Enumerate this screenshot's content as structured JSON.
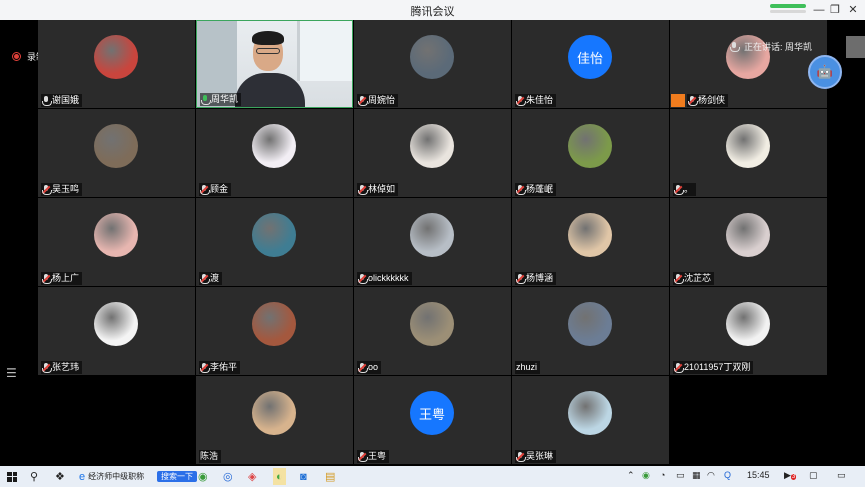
{
  "window": {
    "title": "腾讯会议",
    "minimize_glyph": "—",
    "restore_glyph": "❐",
    "close_glyph": "✕"
  },
  "recording": {
    "label": "录制中"
  },
  "speaking": {
    "label": "正在讲话: 周华凯"
  },
  "bot_glyph": "🤖",
  "participants": [
    {
      "name": "谢国娥",
      "mic": "on",
      "avatar_color": "#c9453d"
    },
    {
      "name": "周华凯",
      "mic": "green",
      "video": true
    },
    {
      "name": "周婉怡",
      "mic": "muted",
      "avatar_color": "#5b6a78"
    },
    {
      "name": "朱佳怡",
      "mic": "muted",
      "avatar_text": "佳怡"
    },
    {
      "name": "杨剑侠",
      "mic": "muted",
      "avatar_color": "#e7a7a1",
      "badge": true
    },
    {
      "name": "吴玉鸣",
      "mic": "muted",
      "avatar_color": "#7e6c59"
    },
    {
      "name": "顾金",
      "mic": "muted",
      "avatar_color": "#f2eef4"
    },
    {
      "name": "林倬如",
      "mic": "muted",
      "avatar_color": "#e9e4de"
    },
    {
      "name": "杨蓬岷",
      "mic": "muted",
      "avatar_color": "#7c9a4a"
    },
    {
      "name": "。",
      "mic": "muted",
      "avatar_color": "#f1ede3"
    },
    {
      "name": "杨上广",
      "mic": "muted",
      "avatar_color": "#e7b6b0"
    },
    {
      "name": "渡",
      "mic": "muted",
      "avatar_color": "#3f7d93"
    },
    {
      "name": "olickkkkkk",
      "mic": "muted",
      "avatar_color": "#b7bec6"
    },
    {
      "name": "杨博涵",
      "mic": "muted",
      "avatar_color": "#e0c6a7"
    },
    {
      "name": "沈芷芯",
      "mic": "muted",
      "avatar_color": "#d9cfcf"
    },
    {
      "name": "张艺玮",
      "mic": "muted",
      "avatar_color": "#f4f4f4"
    },
    {
      "name": "李佑平",
      "mic": "muted",
      "avatar_color": "#a4583e"
    },
    {
      "name": "oo",
      "mic": "muted",
      "avatar_color": "#9c8f76"
    },
    {
      "name": "zhuzi",
      "mic": "none",
      "avatar_color": "#6c7d95"
    },
    {
      "name": "21011957丁双刚",
      "mic": "muted",
      "avatar_color": "#f2f2f2"
    },
    {
      "name": "陈浩",
      "mic": "none",
      "avatar_color": "#d7b38d"
    },
    {
      "name": "王粤",
      "mic": "muted",
      "avatar_text": "王粤"
    },
    {
      "name": "吴张琳",
      "mic": "muted",
      "avatar_color": "#bcd6e4"
    }
  ],
  "taskbar": {
    "app_label": "经济师中级职称",
    "search_label": "搜索一下",
    "time": "15:45",
    "notif_count": "3"
  }
}
